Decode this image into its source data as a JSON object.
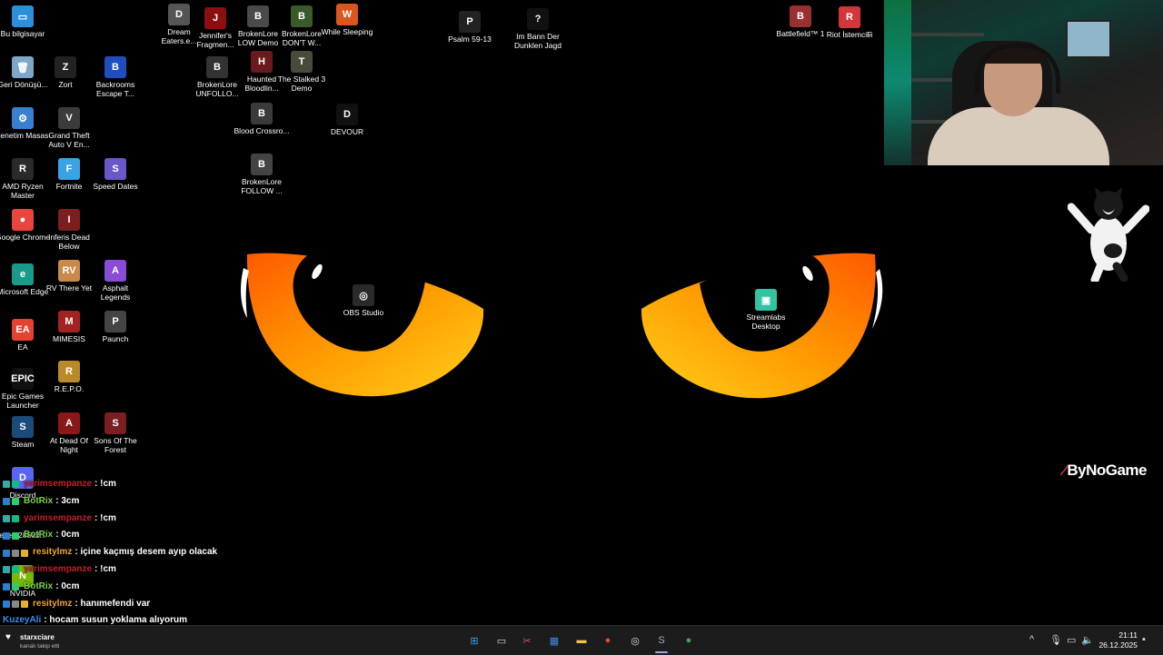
{
  "desktop": {
    "icons": [
      {
        "name": "this-pc",
        "label": "Bu bilgisayar",
        "bg": "#2b8fd9",
        "glyph": "▭",
        "shortcut": false
      },
      {
        "name": "recycle-bin",
        "label": "Geri Dönüşü...",
        "bg": "#7fa6c7",
        "glyph": "🗑",
        "shortcut": false
      },
      {
        "name": "zort",
        "label": "Zort",
        "bg": "#222",
        "glyph": "Z",
        "shortcut": true
      },
      {
        "name": "backrooms",
        "label": "Backrooms Escape T...",
        "bg": "#1f4fbf",
        "glyph": "B",
        "shortcut": true
      },
      {
        "name": "control-panel",
        "label": "Denetim Masası",
        "bg": "#3a7fd0",
        "glyph": "⚙",
        "shortcut": false
      },
      {
        "name": "gta-v",
        "label": "Grand Theft Auto V En...",
        "bg": "#3b3b3b",
        "glyph": "V",
        "shortcut": true
      },
      {
        "name": "amd-ryzen",
        "label": "AMD Ryzen Master",
        "bg": "#2a2a2a",
        "glyph": "R",
        "shortcut": true
      },
      {
        "name": "fortnite",
        "label": "Fortnite",
        "bg": "#3aa3e6",
        "glyph": "F",
        "shortcut": true
      },
      {
        "name": "speed-dates",
        "label": "Speed Dates",
        "bg": "#6a58c9",
        "glyph": "S",
        "shortcut": true
      },
      {
        "name": "google-chrome",
        "label": "Google Chrome",
        "bg": "#e8453c",
        "glyph": "●",
        "shortcut": true
      },
      {
        "name": "inferis-dead-below",
        "label": "Inferis Dead Below",
        "bg": "#7a1e1e",
        "glyph": "I",
        "shortcut": true
      },
      {
        "name": "microsoft-edge",
        "label": "Microsoft Edge",
        "bg": "#1a9a8a",
        "glyph": "e",
        "shortcut": true
      },
      {
        "name": "rv-there-yet",
        "label": "RV There Yet",
        "bg": "#c9894a",
        "glyph": "RV",
        "shortcut": true
      },
      {
        "name": "asphalt-legends",
        "label": "Asphalt Legends",
        "bg": "#8a4cd6",
        "glyph": "A",
        "shortcut": true
      },
      {
        "name": "ea",
        "label": "EA",
        "bg": "#e3432f",
        "glyph": "EA",
        "shortcut": true
      },
      {
        "name": "mimesis",
        "label": "MIMESIS",
        "bg": "#a32222",
        "glyph": "M",
        "shortcut": true
      },
      {
        "name": "paunch",
        "label": "Paunch",
        "bg": "#444",
        "glyph": "P",
        "shortcut": true
      },
      {
        "name": "epic-games",
        "label": "Epic Games Launcher",
        "bg": "#111",
        "glyph": "EPIC",
        "shortcut": false
      },
      {
        "name": "repo",
        "label": "R.E.P.O.",
        "bg": "#b98a2a",
        "glyph": "R",
        "shortcut": true
      },
      {
        "name": "steam",
        "label": "Steam",
        "bg": "#1b4b7a",
        "glyph": "S",
        "shortcut": true
      },
      {
        "name": "at-dead-of-night",
        "label": "At Dead Of Night",
        "bg": "#8a1818",
        "glyph": "A",
        "shortcut": true
      },
      {
        "name": "sons-of-the-forest",
        "label": "Sons Of The Forest",
        "bg": "#7a1e22",
        "glyph": "S",
        "shortcut": true
      },
      {
        "name": "discord",
        "label": "Discord",
        "bg": "#5865f2",
        "glyph": "D",
        "shortcut": true
      },
      {
        "name": "eyes",
        "label": "eyes-28582...",
        "bg": "#222",
        "glyph": "",
        "shortcut": false
      },
      {
        "name": "nvidia",
        "label": "NVIDIA",
        "bg": "#76b900",
        "glyph": "N",
        "shortcut": true
      },
      {
        "name": "dream-eaters",
        "label": "Dream Eaters.e...",
        "bg": "#555",
        "glyph": "D",
        "shortcut": true
      },
      {
        "name": "jennifers-fragments",
        "label": "Jennifer's Fragmen...",
        "bg": "#8a1010",
        "glyph": "J",
        "shortcut": true
      },
      {
        "name": "brokenlore-unfollow",
        "label": "BrokenLore UNFOLLO...",
        "bg": "#333",
        "glyph": "B",
        "shortcut": true
      },
      {
        "name": "brokenlore-low",
        "label": "BrokenLore LOW Demo",
        "bg": "#4a4a4a",
        "glyph": "B",
        "shortcut": true
      },
      {
        "name": "haunted-bloodlines",
        "label": "Haunted Bloodlin...",
        "bg": "#6a1a1a",
        "glyph": "H",
        "shortcut": true
      },
      {
        "name": "blood-crossroads",
        "label": "Blood Crossro...",
        "bg": "#3a3a3a",
        "glyph": "B",
        "shortcut": true
      },
      {
        "name": "brokenlore-follow",
        "label": "BrokenLore FOLLOW ...",
        "bg": "#444",
        "glyph": "B",
        "shortcut": true
      },
      {
        "name": "brokenlore-dont-watch",
        "label": "BrokenLore DON'T W...",
        "bg": "#3a5a2a",
        "glyph": "B",
        "shortcut": true
      },
      {
        "name": "the-stalked-3",
        "label": "The Stalked 3 Demo",
        "bg": "#4a4a3a",
        "glyph": "T",
        "shortcut": true
      },
      {
        "name": "while-sleeping",
        "label": "While Sleeping",
        "bg": "#d9561f",
        "glyph": "W",
        "shortcut": true
      },
      {
        "name": "devour",
        "label": "DEVOUR",
        "bg": "#111",
        "glyph": "D",
        "shortcut": true
      },
      {
        "name": "psalm-59-13",
        "label": "Psalm 59-13",
        "bg": "#222",
        "glyph": "P",
        "shortcut": true
      },
      {
        "name": "im-bann-der-dunklen-jagd",
        "label": "Im Bann Der Dunklen Jagd",
        "bg": "#111",
        "glyph": "?",
        "shortcut": false
      },
      {
        "name": "obs-studio",
        "label": "OBS Studio",
        "bg": "#2a2a2a",
        "glyph": "◎",
        "shortcut": true
      },
      {
        "name": "streamlabs-desktop",
        "label": "Streamlabs Desktop",
        "bg": "#31c3a2",
        "glyph": "▣",
        "shortcut": true
      },
      {
        "name": "battlefield-1",
        "label": "Battlefield™ 1",
        "bg": "#9a2f2f",
        "glyph": "B",
        "shortcut": true
      },
      {
        "name": "riot-client",
        "label": "Riot İstemcisi",
        "bg": "#d13639",
        "glyph": "R",
        "shortcut": true
      },
      {
        "name": "partial-icon",
        "label": "F",
        "bg": "#111",
        "glyph": "",
        "shortcut": false
      }
    ]
  },
  "watermark": {
    "text": "ByNoGame",
    "mark": "⁄"
  },
  "chat": [
    {
      "user": "yarimsempanze",
      "user_color": "#c71e2a",
      "text": ": !cm",
      "badges": [
        "#3aa",
        "#1b8"
      ]
    },
    {
      "user": "BotRix",
      "user_color": "#7ad34a",
      "text": ": 3cm",
      "badges": [
        "#2a7fd0",
        "#2ecc71"
      ]
    },
    {
      "user": "yarimsempanze",
      "user_color": "#c71e2a",
      "text": ": !cm",
      "badges": [
        "#3aa",
        "#1b8"
      ]
    },
    {
      "user": "BotRix",
      "user_color": "#7ad34a",
      "text": ": 0cm",
      "badges": [
        "#2a7fd0",
        "#2ecc71"
      ]
    },
    {
      "user": "resitylmz",
      "user_color": "#f1a532",
      "text": ": içine kaçmış desem ayıp olacak",
      "badges": [
        "#2a7fd0",
        "#888",
        "#e6b12a"
      ]
    },
    {
      "user": "yarimsempanze",
      "user_color": "#c71e2a",
      "text": ": !cm",
      "badges": [
        "#3aa",
        "#1b8"
      ]
    },
    {
      "user": "BotRix",
      "user_color": "#7ad34a",
      "text": ": 0cm",
      "badges": [
        "#2a7fd0",
        "#2ecc71"
      ]
    },
    {
      "user": "resitylmz",
      "user_color": "#f1a532",
      "text": ": hanımefendi var",
      "badges": [
        "#2a7fd0",
        "#888",
        "#e6b12a"
      ]
    },
    {
      "user": "KuzeyAli",
      "user_color": "#3b8df0",
      "text": ": hocam susun yoklama alıyorum",
      "badges": []
    }
  ],
  "notification": {
    "user": "starxciare",
    "text": "kanalı takip etti"
  },
  "taskbar": {
    "apps": [
      {
        "name": "start",
        "glyph": "⊞",
        "color": "#3aa0f2"
      },
      {
        "name": "task-view",
        "glyph": "▭",
        "color": "#ddd"
      },
      {
        "name": "snipping-tool",
        "glyph": "✂",
        "color": "#e04a7a"
      },
      {
        "name": "store",
        "glyph": "▦",
        "color": "#3b8de0"
      },
      {
        "name": "file-explorer",
        "glyph": "▬",
        "color": "#f2c23a"
      },
      {
        "name": "chrome",
        "glyph": "●",
        "color": "#e8453c"
      },
      {
        "name": "obs",
        "glyph": "◎",
        "color": "#ddd"
      },
      {
        "name": "steam",
        "glyph": "S",
        "color": "#9ac"
      },
      {
        "name": "chrome-2",
        "glyph": "●",
        "color": "#46a35c"
      }
    ],
    "time": "21:11",
    "date": "26.12.2025"
  }
}
